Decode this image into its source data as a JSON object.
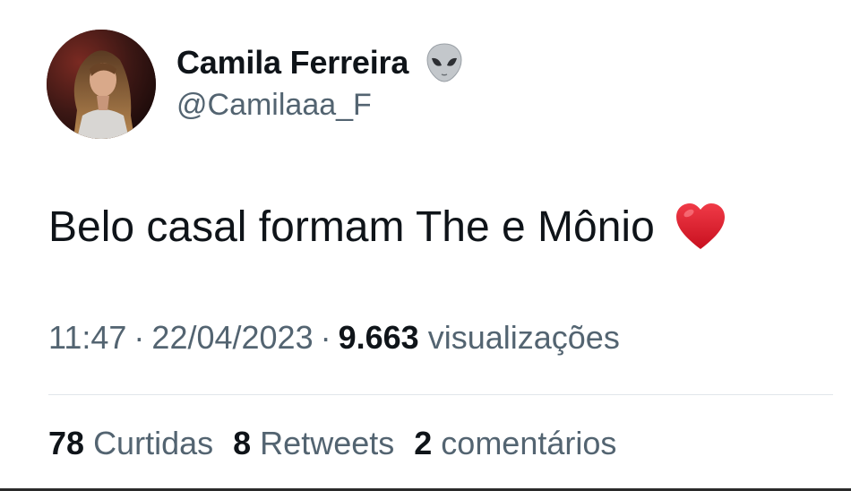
{
  "author": {
    "display_name": "Camila Ferreira",
    "name_emoji": "alien-icon",
    "handle": "@Camilaaa_F"
  },
  "tweet": {
    "text": "Belo casal formam The e Mônio",
    "text_emoji": "red-heart-icon"
  },
  "meta": {
    "time": "11:47",
    "separator": "·",
    "date": "22/04/2023",
    "views_count": "9.663",
    "views_label": "visualizações"
  },
  "stats": {
    "likes_count": "78",
    "likes_label": "Curtidas",
    "retweets_count": "8",
    "retweets_label": "Retweets",
    "comments_count": "2",
    "comments_label": "comentários"
  },
  "colors": {
    "primary_text": "#0f1419",
    "secondary_text": "#536471",
    "heart": "#e0162b",
    "divider": "#e1e6ea"
  }
}
